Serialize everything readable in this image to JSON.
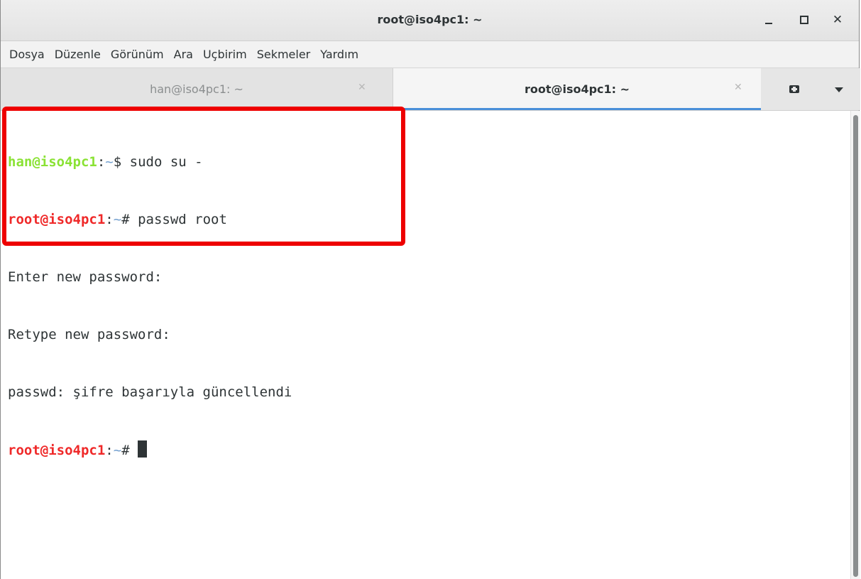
{
  "window": {
    "title": "root@iso4pc1: ~"
  },
  "menu": [
    "Dosya",
    "Düzenle",
    "Görünüm",
    "Ara",
    "Uçbirim",
    "Sekmeler",
    "Yardım"
  ],
  "tabs": [
    {
      "label": "han@iso4pc1: ~",
      "active": false
    },
    {
      "label": "root@iso4pc1: ~",
      "active": true
    }
  ],
  "terminal": {
    "line1": {
      "user": "han@iso4pc1",
      "sep": ":",
      "path": "~",
      "sym": "$",
      "cmd": " sudo su -"
    },
    "line2": {
      "user": "root@iso4pc1",
      "sep": ":",
      "path": "~",
      "sym": "#",
      "cmd": " passwd root"
    },
    "line3": "Enter new password:",
    "line4": "Retype new password:",
    "line5": "passwd: şifre başarıyla güncellendi",
    "line6": {
      "user": "root@iso4pc1",
      "sep": ":",
      "path": "~",
      "sym": "# "
    }
  },
  "colors": {
    "user_prompt": "#8ae234",
    "root_prompt": "#ef2929",
    "path": "#729fcf",
    "highlight": "#ee0000",
    "tab_accent": "#4a90d9"
  },
  "icons": [
    "minimize-icon",
    "maximize-icon",
    "close-icon",
    "new-tab-icon",
    "tab-menu-dropdown-icon"
  ]
}
